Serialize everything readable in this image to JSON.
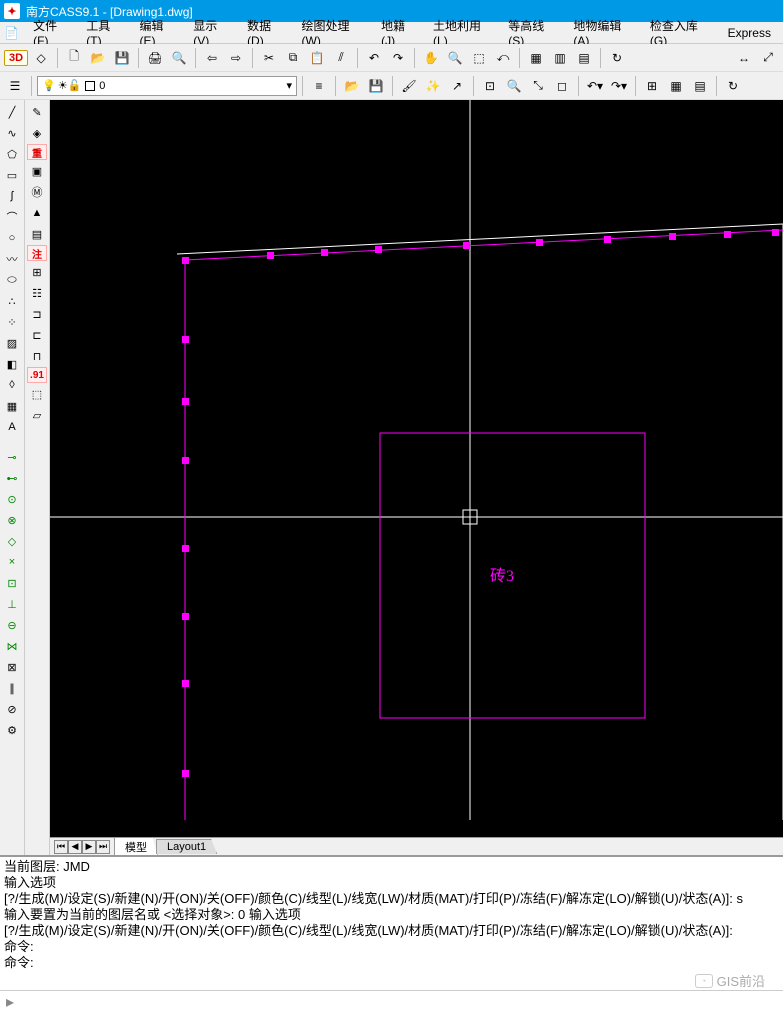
{
  "title": "南方CASS9.1 - [Drawing1.dwg]",
  "menus": {
    "file": "文件(F)",
    "tools": "工具(T)",
    "edit": "编辑(E)",
    "view": "显示(V)",
    "data": "数据(D)",
    "draw": "绘图处理(W)",
    "cadastre": "地籍(J)",
    "landuse": "土地利用(L)",
    "contour": "等高线(S)",
    "feature_edit": "地物编辑(A)",
    "check": "检查入库(G)",
    "express": "Express"
  },
  "badge3d": "3D",
  "layer": {
    "current_display": "0"
  },
  "canvas": {
    "label_text": "砖3",
    "tabs": {
      "model": "模型",
      "layout1": "Layout1"
    }
  },
  "command": {
    "lines": [
      "当前图层:    JMD",
      "输入选项",
      "[?/生成(M)/设定(S)/新建(N)/开(ON)/关(OFF)/颜色(C)/线型(L)/线宽(LW)/材质(MAT)/打印(P)/冻结(F)/解冻定(LO)/解锁(U)/状态(A)]: s",
      "输入要置为当前的图层名或 <选择对象>: 0 输入选项",
      "[?/生成(M)/设定(S)/新建(N)/开(ON)/关(OFF)/颜色(C)/线型(L)/线宽(LW)/材质(MAT)/打印(P)/冻结(F)/解冻定(LO)/解锁(U)/状态(A)]:",
      "命令:",
      "命令:"
    ]
  },
  "watermark": "GIS前沿"
}
